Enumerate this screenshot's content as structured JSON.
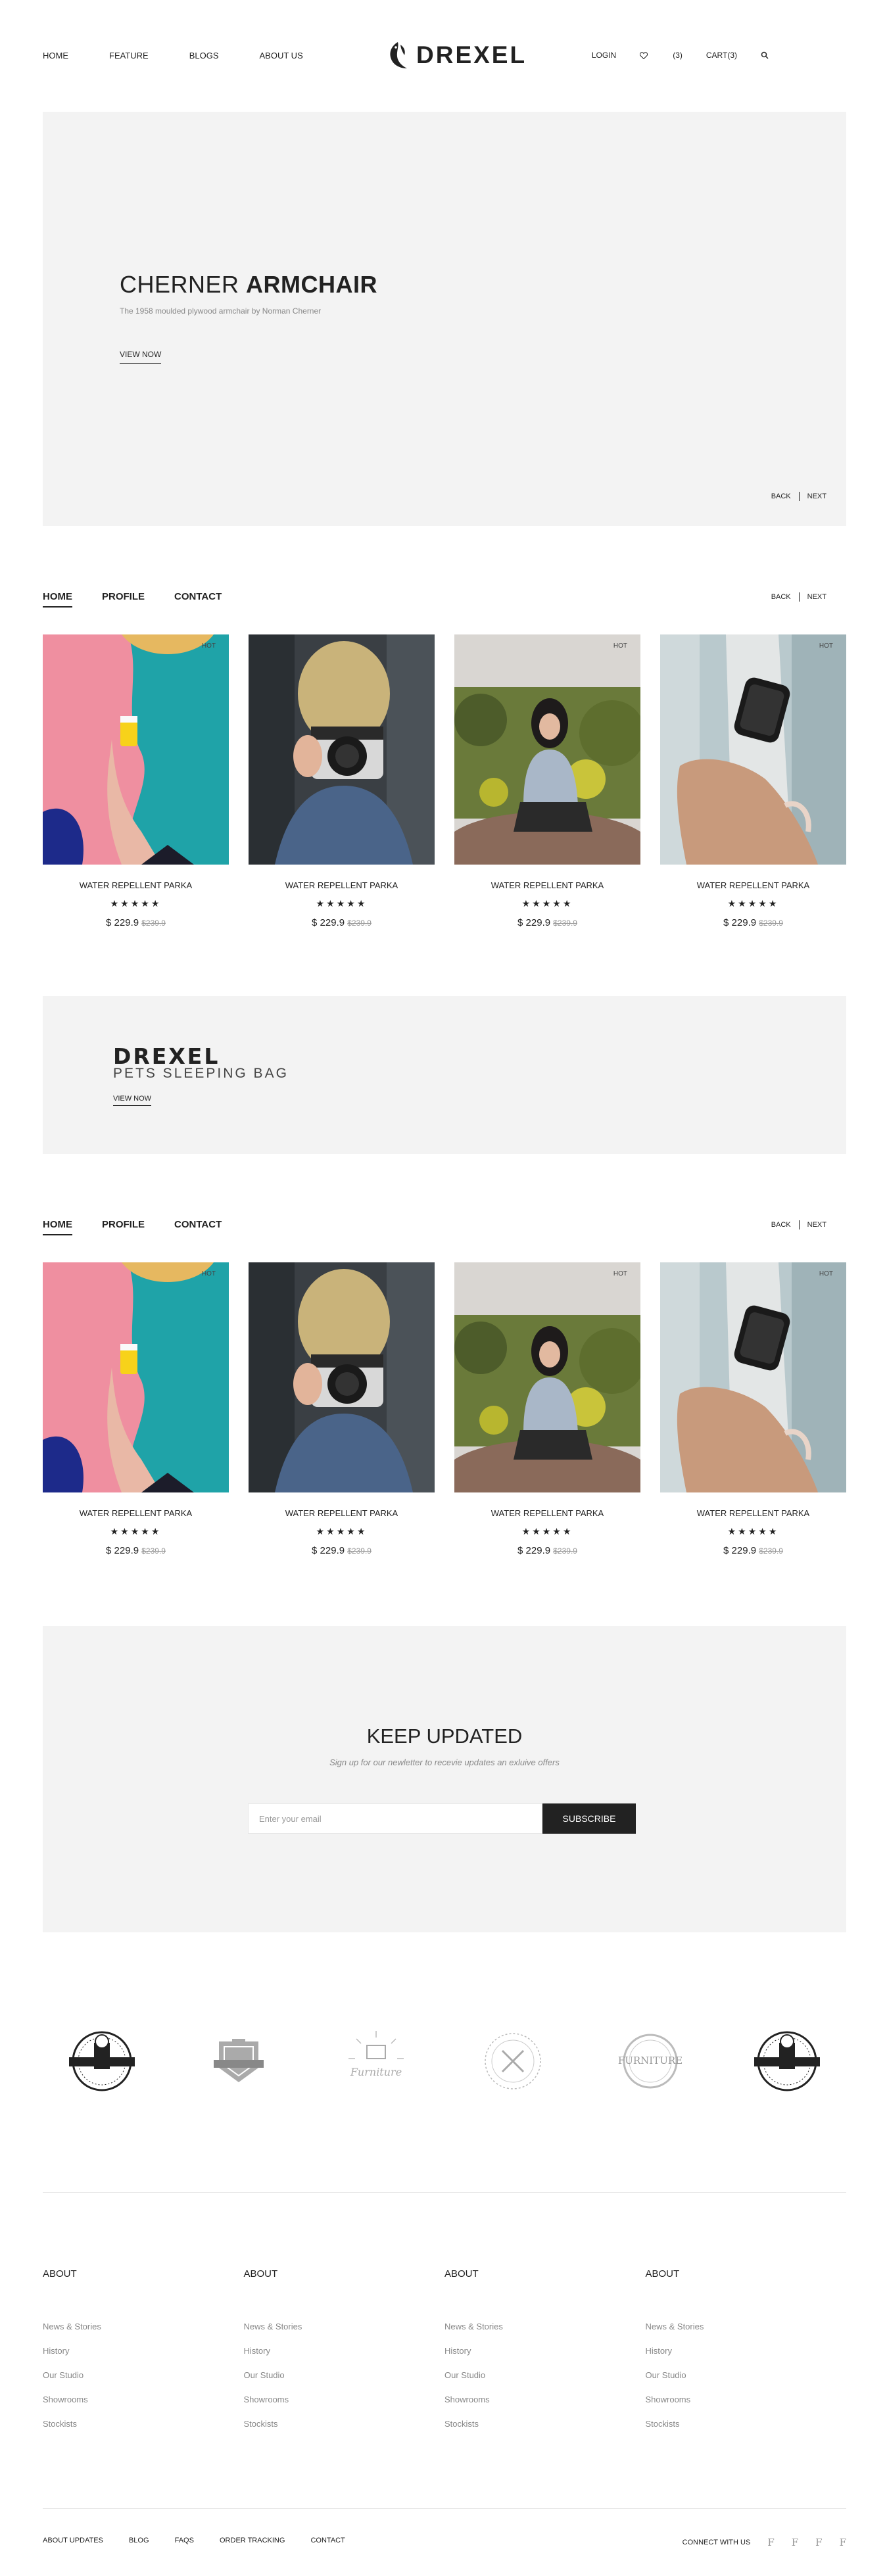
{
  "header": {
    "nav_left": [
      "HOME",
      "FEATURE",
      "BLOGS",
      "ABOUT US"
    ],
    "logo": "DREXEL",
    "login": "LOGIN",
    "wishlist_count": "(3)",
    "cart": "CART(3)",
    "icons": [
      "heart-icon",
      "search-icon"
    ]
  },
  "hero": {
    "title_light": "CHERNER ",
    "title_bold": "ARMCHAIR",
    "subtitle": "The 1958 moulded plywood armchair by Norman Cherner",
    "cta": "VIEW NOW",
    "back": "BACK",
    "next": "NEXT"
  },
  "section1": {
    "tabs": [
      "HOME",
      "PROFILE",
      "CONTACT"
    ],
    "back": "BACK",
    "next": "NEXT"
  },
  "section2": {
    "tabs": [
      "HOME",
      "PROFILE",
      "CONTACT"
    ],
    "back": "BACK",
    "next": "NEXT"
  },
  "products": [
    {
      "name": "WATER REPELLENT PARKA",
      "stars": "★★★★★",
      "price": "$ 229.9",
      "old_price": "$239.9",
      "badge": "HOT",
      "image": "coffee-cup-hand"
    },
    {
      "name": "WATER REPELLENT PARKA",
      "stars": "★★★★★",
      "price": "$ 229.9",
      "old_price": "$239.9",
      "badge": "",
      "image": "person-with-camera"
    },
    {
      "name": "WATER REPELLENT PARKA",
      "stars": "★★★★★",
      "price": "$ 229.9",
      "old_price": "$239.9",
      "badge": "HOT",
      "image": "woman-sitting-on-rock"
    },
    {
      "name": "WATER REPELLENT PARKA",
      "stars": "★★★★★",
      "price": "$ 229.9",
      "old_price": "$239.9",
      "badge": "HOT",
      "image": "smartwatch-wrist"
    }
  ],
  "banner": {
    "brand": "DREXEL",
    "subtitle": "PETS SLEEPING BAG",
    "cta": "VIEW NOW"
  },
  "newsletter": {
    "title": "KEEP UPDATED",
    "subtitle": "Sign up for our newletter to recevie updates an exluive offers",
    "placeholder": "Enter your email",
    "button": "SUBSCRIBE"
  },
  "brands": [
    "premium-quality-badge",
    "shield-badge",
    "furniture-sunburst-badge",
    "tools-circle-badge",
    "furniture-circle-badge",
    "premium-quality-badge"
  ],
  "footer": {
    "columns": [
      {
        "title": "ABOUT",
        "links": [
          "News & Stories",
          "History",
          "Our Studio",
          "Showrooms",
          "Stockists"
        ]
      },
      {
        "title": "ABOUT",
        "links": [
          "News & Stories",
          "History",
          "Our Studio",
          "Showrooms",
          "Stockists"
        ]
      },
      {
        "title": "ABOUT",
        "links": [
          "News & Stories",
          "History",
          "Our Studio",
          "Showrooms",
          "Stockists"
        ]
      },
      {
        "title": "ABOUT",
        "links": [
          "News & Stories",
          "History",
          "Our Studio",
          "Showrooms",
          "Stockists"
        ]
      }
    ],
    "bottom_links": [
      "ABOUT UPDATES",
      "BLOG",
      "FAQS",
      "ORDER TRACKING",
      "CONTACT"
    ],
    "connect": "CONNECT WITH US",
    "social": [
      "f",
      "f",
      "f",
      "f"
    ],
    "social_icons": [
      "facebook-icon",
      "facebook-icon",
      "facebook-icon",
      "facebook-icon"
    ]
  },
  "colors": {
    "text": "#222222",
    "panel": "#f3f3f3",
    "muted": "#888888",
    "button": "#222222"
  }
}
